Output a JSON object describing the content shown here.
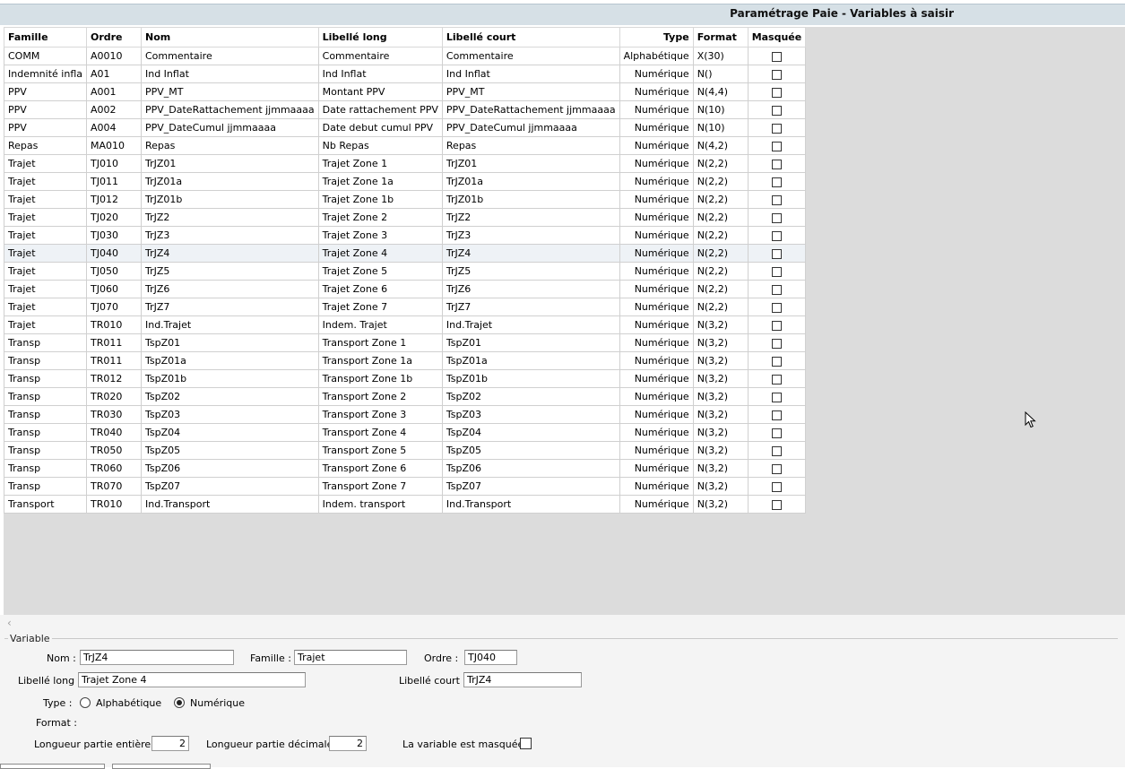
{
  "window": {
    "title": "Paramétrage Paie - Variables à saisir"
  },
  "table": {
    "columns": [
      "Famille",
      "Ordre",
      "Nom",
      "Libellé long",
      "Libellé court",
      "Type",
      "Format",
      "Masquée"
    ],
    "selected_index": 11,
    "rows": [
      {
        "famille": "COMM",
        "ordre": "A0010",
        "nom": "Commentaire",
        "libelle_long": "Commentaire",
        "libelle_court": "Commentaire",
        "type": "Alphabétique",
        "format": "X(30)",
        "masquee": false
      },
      {
        "famille": "Indemnité infla",
        "ordre": "A01",
        "nom": "Ind Inflat",
        "libelle_long": "Ind Inflat",
        "libelle_court": "Ind Inflat",
        "type": "Numérique",
        "format": "N()",
        "masquee": false
      },
      {
        "famille": "PPV",
        "ordre": "A001",
        "nom": "PPV_MT",
        "libelle_long": "Montant PPV",
        "libelle_court": "PPV_MT",
        "type": "Numérique",
        "format": "N(4,4)",
        "masquee": false
      },
      {
        "famille": "PPV",
        "ordre": "A002",
        "nom": "PPV_DateRattachement jjmmaaaa",
        "libelle_long": "Date rattachement PPV",
        "libelle_court": "PPV_DateRattachement jjmmaaaa",
        "type": "Numérique",
        "format": "N(10)",
        "masquee": false
      },
      {
        "famille": "PPV",
        "ordre": "A004",
        "nom": "PPV_DateCumul jjmmaaaa",
        "libelle_long": "Date debut cumul PPV",
        "libelle_court": "PPV_DateCumul jjmmaaaa",
        "type": "Numérique",
        "format": "N(10)",
        "masquee": false
      },
      {
        "famille": "Repas",
        "ordre": "MA010",
        "nom": "Repas",
        "libelle_long": "Nb Repas",
        "libelle_court": "Repas",
        "type": "Numérique",
        "format": "N(4,2)",
        "masquee": false
      },
      {
        "famille": "Trajet",
        "ordre": "TJ010",
        "nom": "TrJZ01",
        "libelle_long": "Trajet Zone 1",
        "libelle_court": "TrJZ01",
        "type": "Numérique",
        "format": "N(2,2)",
        "masquee": false
      },
      {
        "famille": "Trajet",
        "ordre": "TJ011",
        "nom": "TrJZ01a",
        "libelle_long": "Trajet Zone 1a",
        "libelle_court": "TrJZ01a",
        "type": "Numérique",
        "format": "N(2,2)",
        "masquee": false
      },
      {
        "famille": "Trajet",
        "ordre": "TJ012",
        "nom": "TrJZ01b",
        "libelle_long": "Trajet Zone 1b",
        "libelle_court": "TrJZ01b",
        "type": "Numérique",
        "format": "N(2,2)",
        "masquee": false
      },
      {
        "famille": "Trajet",
        "ordre": "TJ020",
        "nom": "TrJZ2",
        "libelle_long": "Trajet Zone 2",
        "libelle_court": "TrJZ2",
        "type": "Numérique",
        "format": "N(2,2)",
        "masquee": false
      },
      {
        "famille": "Trajet",
        "ordre": "TJ030",
        "nom": "TrJZ3",
        "libelle_long": "Trajet Zone 3",
        "libelle_court": "TrJZ3",
        "type": "Numérique",
        "format": "N(2,2)",
        "masquee": false
      },
      {
        "famille": "Trajet",
        "ordre": "TJ040",
        "nom": "TrJZ4",
        "libelle_long": "Trajet Zone 4",
        "libelle_court": "TrJZ4",
        "type": "Numérique",
        "format": "N(2,2)",
        "masquee": false
      },
      {
        "famille": "Trajet",
        "ordre": "TJ050",
        "nom": "TrJZ5",
        "libelle_long": "Trajet Zone 5",
        "libelle_court": "TrJZ5",
        "type": "Numérique",
        "format": "N(2,2)",
        "masquee": false
      },
      {
        "famille": "Trajet",
        "ordre": "TJ060",
        "nom": "TrJZ6",
        "libelle_long": "Trajet Zone 6",
        "libelle_court": "TrJZ6",
        "type": "Numérique",
        "format": "N(2,2)",
        "masquee": false
      },
      {
        "famille": "Trajet",
        "ordre": "TJ070",
        "nom": "TrJZ7",
        "libelle_long": "Trajet Zone 7",
        "libelle_court": "TrJZ7",
        "type": "Numérique",
        "format": "N(2,2)",
        "masquee": false
      },
      {
        "famille": "Trajet",
        "ordre": "TR010",
        "nom": "Ind.Trajet",
        "libelle_long": "Indem. Trajet",
        "libelle_court": "Ind.Trajet",
        "type": "Numérique",
        "format": "N(3,2)",
        "masquee": false
      },
      {
        "famille": "Transp",
        "ordre": "TR011",
        "nom": "TspZ01",
        "libelle_long": "Transport Zone 1",
        "libelle_court": "TspZ01",
        "type": "Numérique",
        "format": "N(3,2)",
        "masquee": false
      },
      {
        "famille": "Transp",
        "ordre": "TR011",
        "nom": "TspZ01a",
        "libelle_long": "Transport Zone 1a",
        "libelle_court": "TspZ01a",
        "type": "Numérique",
        "format": "N(3,2)",
        "masquee": false
      },
      {
        "famille": "Transp",
        "ordre": "TR012",
        "nom": "TspZ01b",
        "libelle_long": "Transport Zone 1b",
        "libelle_court": "TspZ01b",
        "type": "Numérique",
        "format": "N(3,2)",
        "masquee": false
      },
      {
        "famille": "Transp",
        "ordre": "TR020",
        "nom": "TspZ02",
        "libelle_long": "Transport Zone 2",
        "libelle_court": "TspZ02",
        "type": "Numérique",
        "format": "N(3,2)",
        "masquee": false
      },
      {
        "famille": "Transp",
        "ordre": "TR030",
        "nom": "TspZ03",
        "libelle_long": "Transport Zone 3",
        "libelle_court": "TspZ03",
        "type": "Numérique",
        "format": "N(3,2)",
        "masquee": false
      },
      {
        "famille": "Transp",
        "ordre": "TR040",
        "nom": "TspZ04",
        "libelle_long": "Transport Zone 4",
        "libelle_court": "TspZ04",
        "type": "Numérique",
        "format": "N(3,2)",
        "masquee": false
      },
      {
        "famille": "Transp",
        "ordre": "TR050",
        "nom": "TspZ05",
        "libelle_long": "Transport Zone 5",
        "libelle_court": "TspZ05",
        "type": "Numérique",
        "format": "N(3,2)",
        "masquee": false
      },
      {
        "famille": "Transp",
        "ordre": "TR060",
        "nom": "TspZ06",
        "libelle_long": "Transport Zone 6",
        "libelle_court": "TspZ06",
        "type": "Numérique",
        "format": "N(3,2)",
        "masquee": false
      },
      {
        "famille": "Transp",
        "ordre": "TR070",
        "nom": "TspZ07",
        "libelle_long": "Transport Zone 7",
        "libelle_court": "TspZ07",
        "type": "Numérique",
        "format": "N(3,2)",
        "masquee": false
      },
      {
        "famille": "Transport",
        "ordre": "TR010",
        "nom": "Ind.Transport",
        "libelle_long": "Indem. transport",
        "libelle_court": "Ind.Transport",
        "type": "Numérique",
        "format": "N(3,2)",
        "masquee": false
      }
    ]
  },
  "detail": {
    "group_label": "Variable",
    "nom_label": "Nom :",
    "nom_value": "TrJZ4",
    "famille_label": "Famille :",
    "famille_value": "Trajet",
    "ordre_label": "Ordre :",
    "ordre_value": "TJ040",
    "libelle_long_label": "Libellé long :",
    "libelle_long_value": "Trajet Zone 4",
    "libelle_court_label": "Libellé court :",
    "libelle_court_value": "TrJZ4",
    "type_label": "Type :",
    "type_option_alpha": "Alphabétique",
    "type_option_num": "Numérique",
    "type_selected": "Numérique",
    "format_label": "Format :",
    "longueur_entiere_label": "Longueur partie entière :",
    "longueur_entiere_value": "2",
    "longueur_decimale_label": "Longueur partie décimale :",
    "longueur_decimale_value": "2",
    "masquee_label": "La variable est masquée :",
    "masquee_value": false
  },
  "icons": {
    "cursor": "mouse-pointer-icon",
    "scroll_left": "chevron-left-icon"
  },
  "colors": {
    "title_bar": "#d6e0e6",
    "grid_background": "#dcdcdc",
    "panel_background": "#f4f4f4"
  }
}
